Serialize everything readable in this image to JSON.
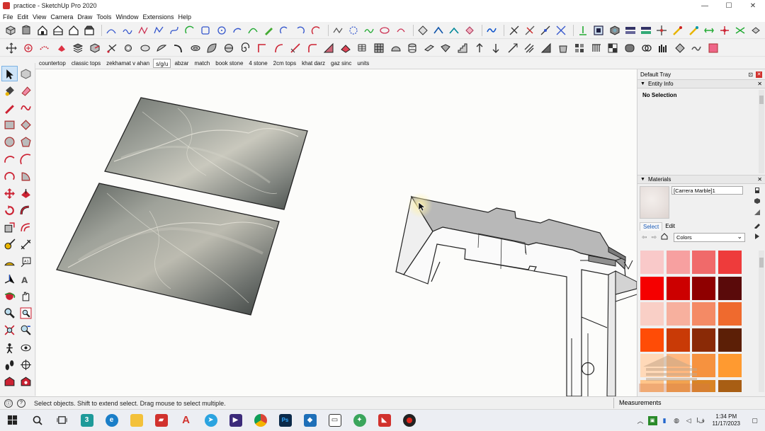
{
  "window": {
    "title": "practice - SketchUp Pro 2020",
    "buttons": [
      "minimize",
      "maximize",
      "close"
    ]
  },
  "menu": [
    "File",
    "Edit",
    "View",
    "Camera",
    "Draw",
    "Tools",
    "Window",
    "Extensions",
    "Help"
  ],
  "scenes": [
    "countertop",
    "classic tops",
    "zekhamat v ahan",
    "s/g/u",
    "abzar",
    "match",
    "book stone",
    "4 stone",
    "2cm tops",
    "khat darz",
    "gaz sinc",
    "units"
  ],
  "active_scene": "s/g/u",
  "tray": {
    "title": "Default Tray",
    "entity_info": {
      "title": "Entity Info",
      "selection": "No Selection"
    },
    "materials": {
      "title": "Materials",
      "current_material": "[Carrera Marble]1",
      "tabs": [
        "Select",
        "Edit"
      ],
      "active_tab": "Select",
      "collection": "Colors",
      "swatches": [
        "#f9c9c9",
        "#f7a0a0",
        "#f06a6a",
        "#ee3b3b",
        "#f50000",
        "#cc0000",
        "#8f0000",
        "#5a0a0a",
        "#f9cfc6",
        "#f7b09e",
        "#f48a65",
        "#ef6a2e",
        "#ff4c06",
        "#c93a06",
        "#8a2a06",
        "#5c1f06",
        "#ffd9b8",
        "#ffb880",
        "#f6923f",
        "#ff9a30",
        "#ffc58a",
        "#f2a24f",
        "#d98425",
        "#a85e14"
      ]
    }
  },
  "status": {
    "message": "Select objects. Shift to extend select. Drag mouse to select multiple.",
    "measurements_label": "Measurements"
  },
  "taskbar": {
    "time": "1:34 PM",
    "date": "11/17/2023",
    "language": "ﻑﺍ"
  }
}
